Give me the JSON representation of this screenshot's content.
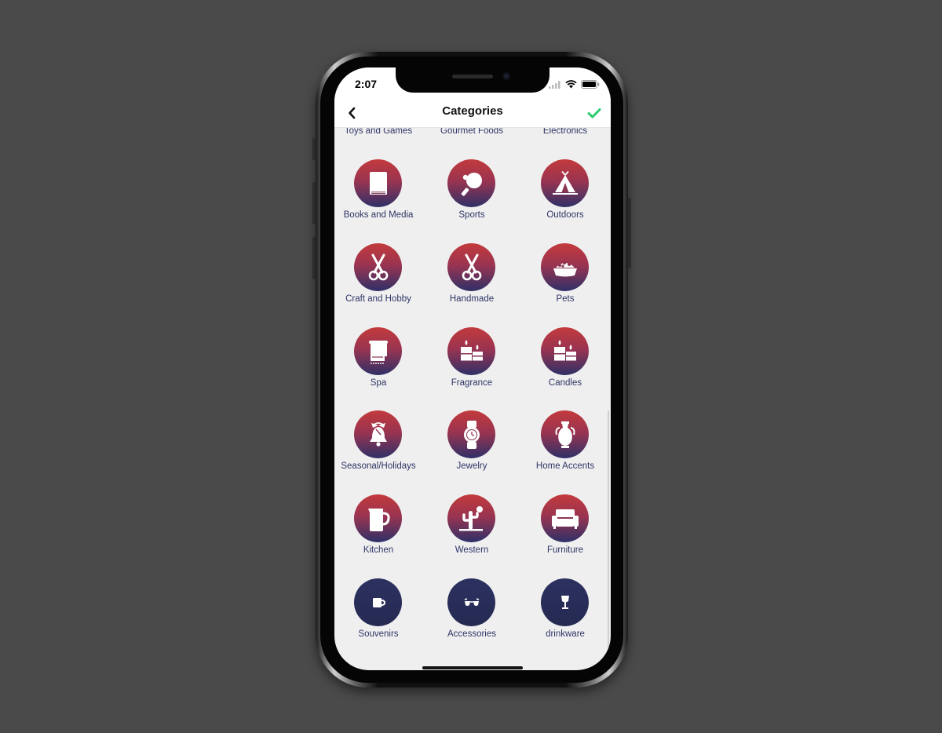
{
  "status_bar": {
    "time": "2:07"
  },
  "nav": {
    "title": "Categories"
  },
  "partial_row": [
    "Toys and Games",
    "Gourmet Foods",
    "Electronics"
  ],
  "categories": [
    {
      "label": "Books and Media",
      "icon": "book-icon"
    },
    {
      "label": "Sports",
      "icon": "ping-pong-icon"
    },
    {
      "label": "Outdoors",
      "icon": "tent-icon"
    },
    {
      "label": "Craft and Hobby",
      "icon": "scissors-icon"
    },
    {
      "label": "Handmade",
      "icon": "scissors-icon"
    },
    {
      "label": "Pets",
      "icon": "pet-bowl-icon"
    },
    {
      "label": "Spa",
      "icon": "towel-icon"
    },
    {
      "label": "Fragrance",
      "icon": "candles-icon"
    },
    {
      "label": "Candles",
      "icon": "candles-icon"
    },
    {
      "label": "Seasonal/Holidays",
      "icon": "bell-icon"
    },
    {
      "label": "Jewelry",
      "icon": "watch-icon"
    },
    {
      "label": "Home Accents",
      "icon": "vase-icon"
    },
    {
      "label": "Kitchen",
      "icon": "pitcher-icon"
    },
    {
      "label": "Western",
      "icon": "cactus-icon"
    },
    {
      "label": "Furniture",
      "icon": "armchair-icon"
    },
    {
      "label": "Souvenirs",
      "icon": "mug-icon"
    },
    {
      "label": "Accessories",
      "icon": "sunglasses-icon"
    },
    {
      "label": "drinkware",
      "icon": "wine-glass-icon"
    }
  ],
  "colors": {
    "accent_check": "#2ecc71",
    "label_text": "#2e3566",
    "circle_gradient_top": "#c33a3c",
    "circle_gradient_bottom": "#2f3068",
    "background": "#efefef"
  }
}
